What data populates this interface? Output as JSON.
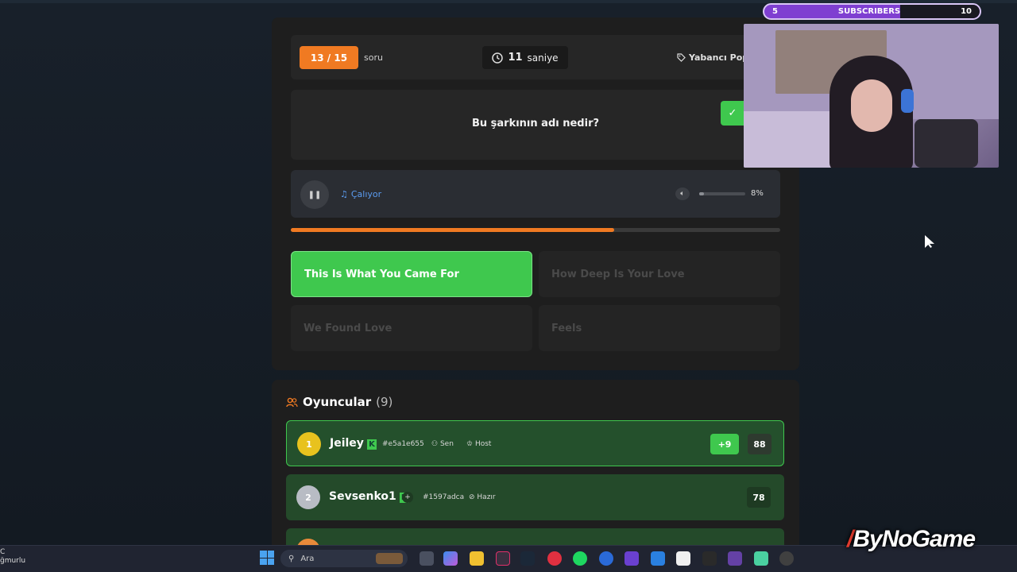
{
  "game": {
    "question_counter": "13 / 15",
    "question_counter_suffix": "soru",
    "timer_value": "11",
    "timer_unit": "saniye",
    "category": "Yabancı Pop",
    "question": "Bu şarkının adı nedir?",
    "player": {
      "status": "Çalıyor",
      "volume_percent": "8%",
      "volume_fraction": 0.08
    },
    "round_progress_fraction": 0.66,
    "answers": [
      {
        "label": "This Is What You Came For",
        "state": "correct"
      },
      {
        "label": "How Deep Is Your Love",
        "state": "disabled"
      },
      {
        "label": "We Found Love",
        "state": "disabled"
      },
      {
        "label": "Feels",
        "state": "disabled"
      }
    ]
  },
  "players": {
    "title": "Oyuncular",
    "count": "(9)",
    "list": [
      {
        "rank": "1",
        "name": "Jeiley",
        "id": "#e5a1e655",
        "tag1": "Sen",
        "tag2": "Host",
        "delta": "+9",
        "score": "88",
        "rank_color": "#e8c21e"
      },
      {
        "rank": "2",
        "name": "Sevsenko1",
        "id": "#1597adca",
        "tag1": "Hazır",
        "tag2": "",
        "delta": "",
        "score": "78",
        "rank_color": "#b8bcc4"
      }
    ]
  },
  "overlay": {
    "sub_left": "5",
    "sub_label": "SUBSCRIBERS",
    "sub_right": "10",
    "brand": "ByNoGame"
  },
  "taskbar": {
    "left_line1": "C",
    "left_line2": "ğmurlu",
    "search_placeholder": "Ara"
  },
  "colors": {
    "accent": "#f07a22",
    "correct": "#3fc84e",
    "panel": "#1e1e1e"
  }
}
